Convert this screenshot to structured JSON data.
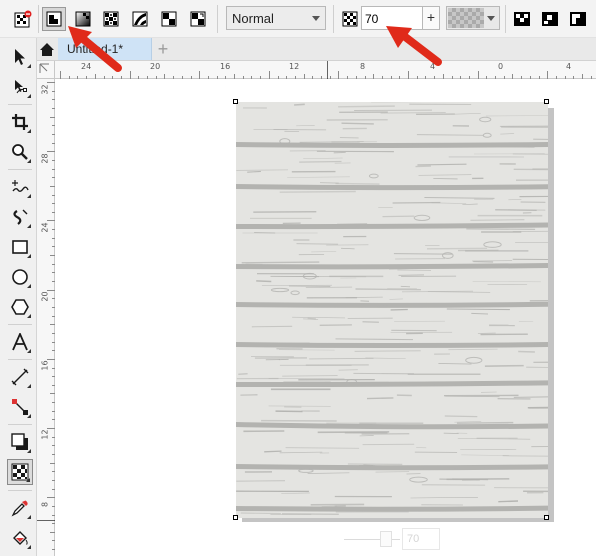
{
  "property_bar": {
    "merge_mode": "Normal",
    "transparency_value": "70",
    "slider_button": "+"
  },
  "document": {
    "tab_title": "Untitled-1*",
    "new_tab_glyph": "+"
  },
  "rulers": {
    "horizontal": [
      "24",
      "20",
      "16",
      "12",
      "8",
      "4",
      "0",
      "4"
    ],
    "vertical": [
      "32",
      "28",
      "24",
      "20",
      "16",
      "12",
      "8"
    ]
  },
  "floating_control": {
    "value": "70"
  },
  "colors": {
    "annotation_arrow": "#e02a1a",
    "wood_base": "#e4e4e1",
    "wood_grain": "#b3b3b0",
    "active_tab": "#cfe3f6"
  },
  "icons": [
    "pick-tool-icon",
    "shape-tool-icon",
    "crop-tool-icon",
    "zoom-tool-icon",
    "freehand-tool-icon",
    "artistic-media-icon",
    "rectangle-tool-icon",
    "ellipse-tool-icon",
    "polygon-tool-icon",
    "text-tool-icon",
    "parallel-dimension-icon",
    "connector-tool-icon",
    "drop-shadow-tool-icon",
    "transparency-tool-icon",
    "color-eyedropper-icon",
    "interactive-fill-icon"
  ]
}
